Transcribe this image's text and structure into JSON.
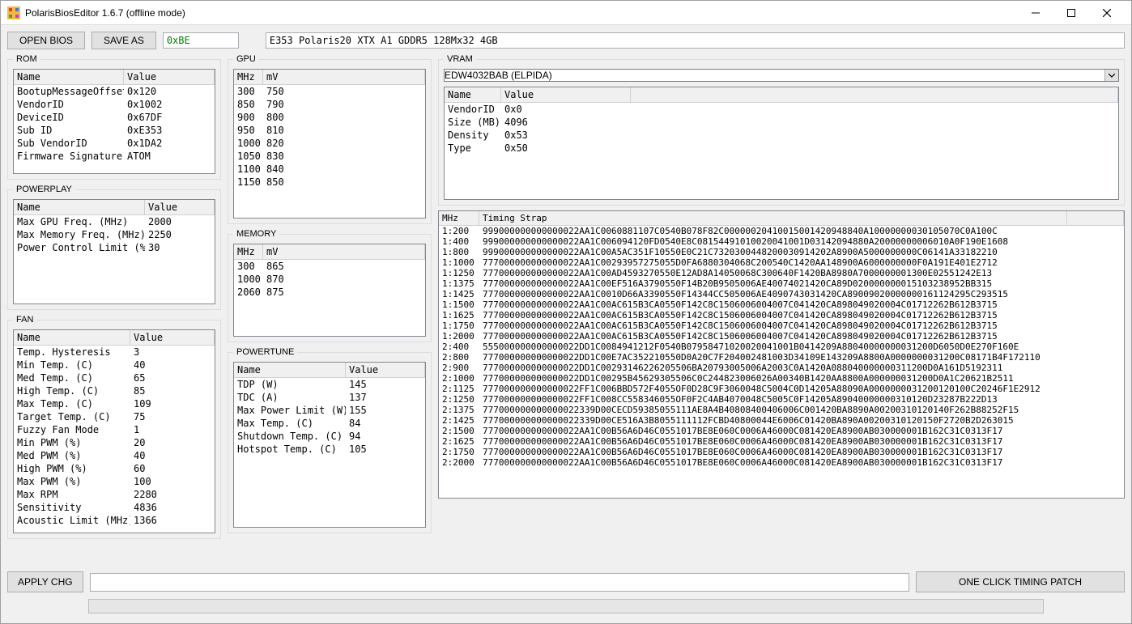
{
  "window": {
    "title": "PolarisBiosEditor 1.6.7 (offline mode)"
  },
  "toolbar": {
    "open_label": "OPEN BIOS",
    "save_label": "SAVE AS",
    "hex_value": "0xBE",
    "device_desc": "E353 Polaris20 XTX A1 GDDR5 128Mx32 4GB"
  },
  "rom": {
    "legend": "ROM",
    "hdr_name": "Name",
    "hdr_value": "Value",
    "rows": [
      {
        "name": "BootupMessageOffset",
        "value": "0x120"
      },
      {
        "name": "VendorID",
        "value": "0x1002"
      },
      {
        "name": "DeviceID",
        "value": "0x67DF"
      },
      {
        "name": "Sub ID",
        "value": "0xE353"
      },
      {
        "name": "Sub VendorID",
        "value": "0x1DA2"
      },
      {
        "name": "Firmware Signature",
        "value": "ATOM"
      }
    ]
  },
  "powerplay": {
    "legend": "POWERPLAY",
    "hdr_name": "Name",
    "hdr_value": "Value",
    "rows": [
      {
        "name": "Max GPU Freq. (MHz)",
        "value": "2000"
      },
      {
        "name": "Max Memory Freq. (MHz)",
        "value": "2250"
      },
      {
        "name": "Power Control Limit (%)",
        "value": "30"
      }
    ]
  },
  "fan": {
    "legend": "FAN",
    "hdr_name": "Name",
    "hdr_value": "Value",
    "rows": [
      {
        "name": "Temp. Hysteresis",
        "value": "3"
      },
      {
        "name": "Min Temp. (C)",
        "value": "40"
      },
      {
        "name": "Med Temp. (C)",
        "value": "65"
      },
      {
        "name": "High Temp. (C)",
        "value": "85"
      },
      {
        "name": "Max Temp. (C)",
        "value": "109"
      },
      {
        "name": "Target Temp. (C)",
        "value": "75"
      },
      {
        "name": "Fuzzy Fan Mode",
        "value": "1"
      },
      {
        "name": "Min PWM (%)",
        "value": "20"
      },
      {
        "name": "Med PWM (%)",
        "value": "40"
      },
      {
        "name": "High PWM (%)",
        "value": "60"
      },
      {
        "name": "Max PWM (%)",
        "value": "100"
      },
      {
        "name": "Max RPM",
        "value": "2280"
      },
      {
        "name": "Sensitivity",
        "value": "4836"
      },
      {
        "name": "Acoustic Limit (MHz)",
        "value": "1366"
      }
    ]
  },
  "gpu": {
    "legend": "GPU",
    "hdr_mhz": "MHz",
    "hdr_mv": "mV",
    "rows": [
      {
        "mhz": "300",
        "mv": "750"
      },
      {
        "mhz": "850",
        "mv": "790"
      },
      {
        "mhz": "900",
        "mv": "800"
      },
      {
        "mhz": "950",
        "mv": "810"
      },
      {
        "mhz": "1000",
        "mv": "820"
      },
      {
        "mhz": "1050",
        "mv": "830"
      },
      {
        "mhz": "1100",
        "mv": "840"
      },
      {
        "mhz": "1150",
        "mv": "850"
      }
    ]
  },
  "memory": {
    "legend": "MEMORY",
    "hdr_mhz": "MHz",
    "hdr_mv": "mV",
    "rows": [
      {
        "mhz": "300",
        "mv": "865"
      },
      {
        "mhz": "1000",
        "mv": "870"
      },
      {
        "mhz": "2060",
        "mv": "875"
      }
    ]
  },
  "powertune": {
    "legend": "POWERTUNE",
    "hdr_name": "Name",
    "hdr_value": "Value",
    "rows": [
      {
        "name": "TDP (W)",
        "value": "145"
      },
      {
        "name": "TDC (A)",
        "value": "137"
      },
      {
        "name": "Max Power Limit (W)",
        "value": "155"
      },
      {
        "name": "Max Temp. (C)",
        "value": "84"
      },
      {
        "name": "Shutdown Temp. (C)",
        "value": "94"
      },
      {
        "name": "Hotspot Temp. (C)",
        "value": "105"
      }
    ]
  },
  "vram": {
    "legend": "VRAM",
    "selected": "EDW4032BAB (ELPIDA)",
    "hdr_name": "Name",
    "hdr_value": "Value",
    "rows": [
      {
        "name": "VendorID",
        "value": "0x0"
      },
      {
        "name": "Size (MB)",
        "value": "4096"
      },
      {
        "name": "Density",
        "value": "0x53"
      },
      {
        "name": "Type",
        "value": "0x50"
      }
    ]
  },
  "timings": {
    "hdr_mhz": "MHz",
    "hdr_strap": "Timing Strap",
    "rows": [
      {
        "mhz": "1:200",
        "strap": "999000000000000022AA1C0060881107C0540B078F82C00000020410015001420948840A10000000030105070C0A100C"
      },
      {
        "mhz": "1:400",
        "strap": "999000000000000022AA1C006094120FD0540E8C08154491010020041001D03142094880A20000000006010A0F190E1608"
      },
      {
        "mhz": "1:800",
        "strap": "999000000000000022AA1C00A5AC351F10550E0C21C7320300448200030914202A8900A5000000000C06141A33182210"
      },
      {
        "mhz": "1:1000",
        "strap": "777000000000000022AA1C00293957275055D0FA6880304068C200540C1420AA148900A6000000000F0A191E401E2712"
      },
      {
        "mhz": "1:1250",
        "strap": "777000000000000022AA1C00AD4593270550E12AD8A14050068C300640F1420BA8980A7000000001300E02551242E13"
      },
      {
        "mhz": "1:1375",
        "strap": "777000000000000022AA1C00EF516A3790550F14B20B9505006AE40074021420CA89D020000000015103238952BB315"
      },
      {
        "mhz": "1:1425",
        "strap": "777000000000000022AA1C0010D66A3390550F14344CC505006AE4090743031420CA89009020000000161124295C293515"
      },
      {
        "mhz": "1:1500",
        "strap": "777000000000000022AA1C00AC615B3CA0550F142C8C1506006004007C041420CA898049020004C01712262B612B3715"
      },
      {
        "mhz": "1:1625",
        "strap": "777000000000000022AA1C00AC615B3CA0550F142C8C1506006004007C041420CA898049020004C01712262B612B3715"
      },
      {
        "mhz": "1:1750",
        "strap": "777000000000000022AA1C00AC615B3CA0550F142C8C1506006004007C041420CA898049020004C01712262B612B3715"
      },
      {
        "mhz": "1:2000",
        "strap": "777000000000000022AA1C00AC615B3CA0550F142C8C1506006004007C041420CA898049020004C01712262B612B3715"
      },
      {
        "mhz": "2:400",
        "strap": "555000000000000022DD1C0084941212F0540B07958471020020041001B0414209A88040000000031200D6050D0E270F160E"
      },
      {
        "mhz": "2:800",
        "strap": "777000000000000022DD1C00E7AC352210550D0A20C7F204002481003D34109E143209A8800A0000000031200C08171B4F172110"
      },
      {
        "mhz": "2:900",
        "strap": "777000000000000022DD1C00293146226205506BA20793005006A2003C0A1420A088040000000311200D0A161D5192311"
      },
      {
        "mhz": "2:1000",
        "strap": "777000000000000022DD1C00295B45629305506C0C244823006026A00340B1420AA8800A000000031200D0A1C20621B2511"
      },
      {
        "mhz": "2:1125",
        "strap": "777000000000000022FF1C006BBD572F4055OF0D28C9F3060048C5004C0D14205A88090A0000000031200120100C20246F1E2912"
      },
      {
        "mhz": "2:1250",
        "strap": "777000000000000022FF1C008CC558346055OF0F2C4AB4070048C5005C0F14205A89040000000310120D23287B222D13"
      },
      {
        "mhz": "2:1375",
        "strap": "777000000000000022339D00CECD59385055111AE8A4B40808400406006C001420BA8890A00200310120140F262B88252F15"
      },
      {
        "mhz": "2:1425",
        "strap": "777000000000000022339D00CE516A3B8055111112FCBD40800044E6006C01420BA890A00200310120150F2720B2D263015"
      },
      {
        "mhz": "2:1500",
        "strap": "777000000000000022AA1C00B56A6D46C0551017BE8E060C0006A46000C081420EA8900AB030000001B162C31C0313F17"
      },
      {
        "mhz": "2:1625",
        "strap": "777000000000000022AA1C00B56A6D46C0551017BE8E060C0006A46000C081420EA8900AB030000001B162C31C0313F17"
      },
      {
        "mhz": "2:1750",
        "strap": "777000000000000022AA1C00B56A6D46C0551017BE8E060C0006A46000C081420EA8900AB030000001B162C31C0313F17"
      },
      {
        "mhz": "2:2000",
        "strap": "777000000000000022AA1C00B56A6D46C0551017BE8E060C0006A46000C081420EA8900AB030000001B162C31C0313F17"
      }
    ]
  },
  "bottom": {
    "apply_label": "APPLY CHG",
    "patch_label": "ONE CLICK TIMING PATCH"
  }
}
